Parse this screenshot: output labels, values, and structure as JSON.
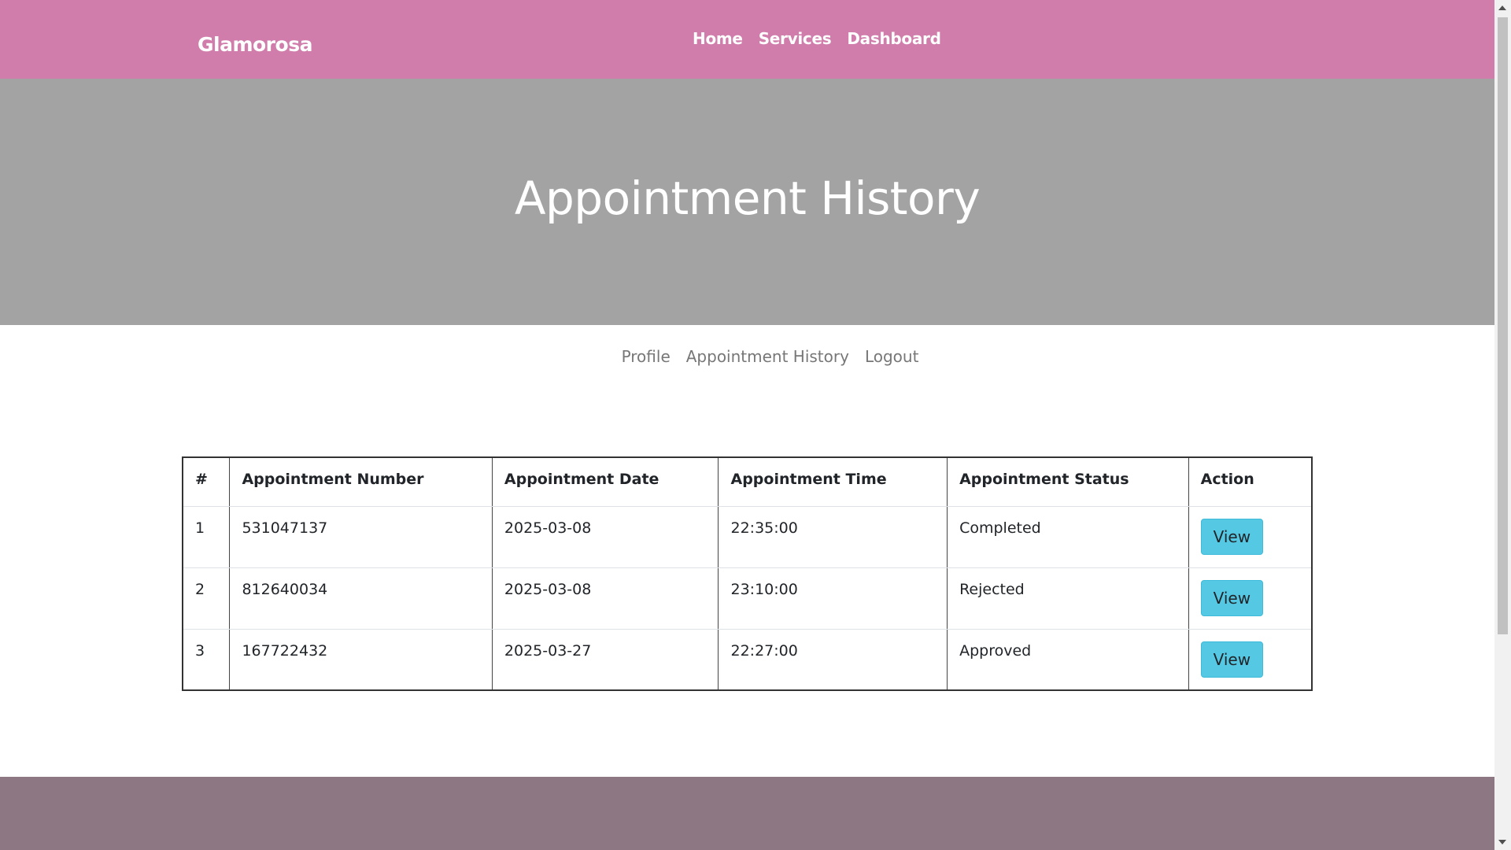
{
  "navbar": {
    "brand": "Glamorosa",
    "links": [
      "Home",
      "Services",
      "Dashboard"
    ]
  },
  "hero": {
    "title": "Appointment History"
  },
  "submenu": {
    "links": [
      "Profile",
      "Appointment History",
      "Logout"
    ]
  },
  "table": {
    "headers": [
      "#",
      "Appointment Number",
      "Appointment Date",
      "Appointment Time",
      "Appointment Status",
      "Action"
    ],
    "rows": [
      {
        "num": "1",
        "number": "531047137",
        "date": "2025-03-08",
        "time": "22:35:00",
        "status": "Completed",
        "action": "View"
      },
      {
        "num": "2",
        "number": "812640034",
        "date": "2025-03-08",
        "time": "23:10:00",
        "status": "Rejected",
        "action": "View"
      },
      {
        "num": "3",
        "number": "167722432",
        "date": "2025-03-27",
        "time": "22:27:00",
        "status": "Approved",
        "action": "View"
      }
    ]
  },
  "colors": {
    "navbar": "#d07dab",
    "hero": "#a3a3a3",
    "button": "#55c8e3",
    "footer": "#8d7782"
  }
}
